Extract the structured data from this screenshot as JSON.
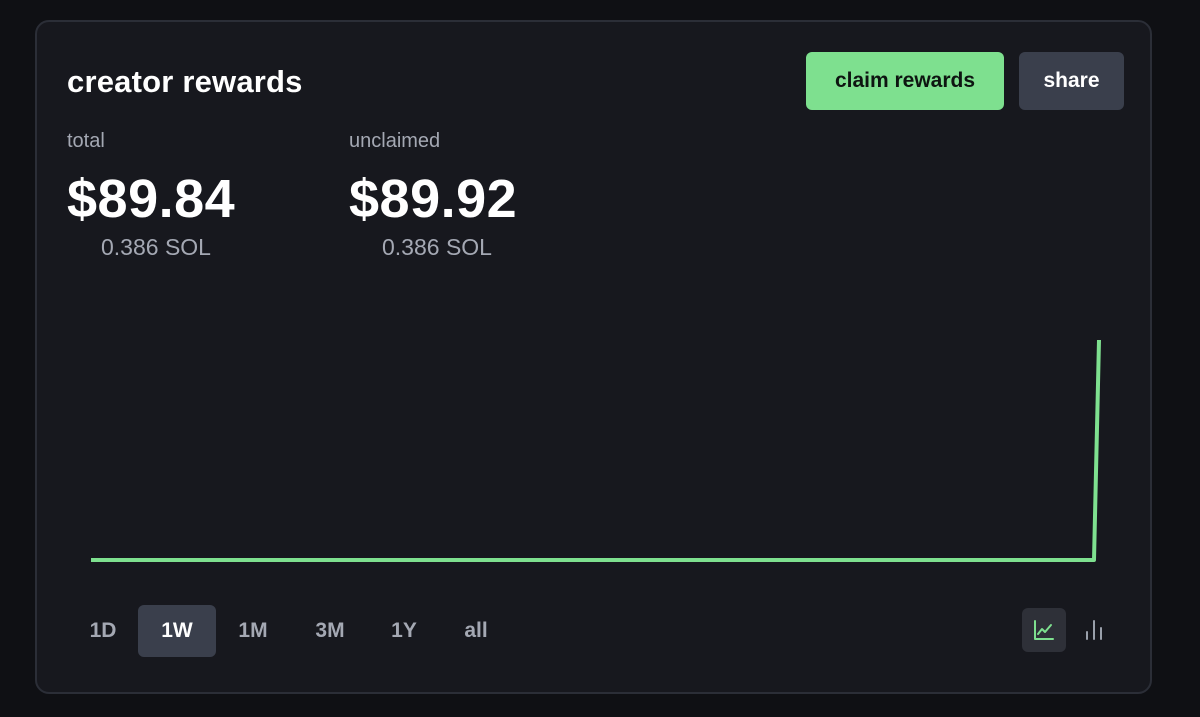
{
  "header": {
    "title": "creator rewards",
    "claim_label": "claim rewards",
    "share_label": "share"
  },
  "stats": {
    "total": {
      "label": "total",
      "usd": "$89.84",
      "sol": "0.386 SOL"
    },
    "unclaimed": {
      "label": "unclaimed",
      "usd": "$89.92",
      "sol": "0.386 SOL"
    }
  },
  "chart_data": {
    "type": "line",
    "x": [
      0,
      0.995,
      1
    ],
    "values": [
      0,
      0,
      89.84
    ],
    "color": "#7ee08f",
    "xlabel": "",
    "ylabel": ""
  },
  "ranges": [
    {
      "label": "1D",
      "active": false
    },
    {
      "label": "1W",
      "active": true
    },
    {
      "label": "1M",
      "active": false
    },
    {
      "label": "3M",
      "active": false
    },
    {
      "label": "1Y",
      "active": false
    },
    {
      "label": "all",
      "active": false
    }
  ],
  "chart_toggles": [
    {
      "icon": "line-chart-icon",
      "active": true
    },
    {
      "icon": "bar-chart-icon",
      "active": false
    }
  ],
  "colors": {
    "accent": "#7ee08f",
    "card_bg": "#17181e",
    "muted_text": "#a4a8b3",
    "button_secondary": "#3a3f4c"
  }
}
